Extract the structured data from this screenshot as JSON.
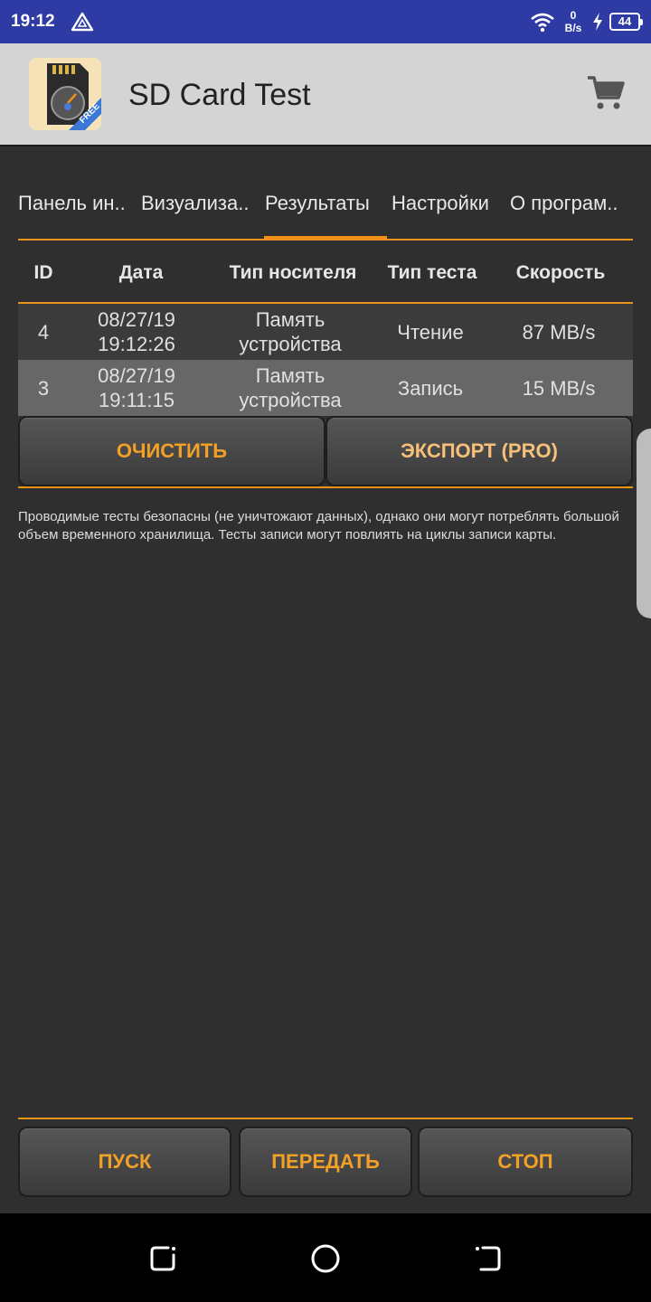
{
  "status_bar": {
    "time": "19:12",
    "net_speed_value": "0",
    "net_speed_unit": "B/s",
    "battery": "44"
  },
  "app_bar": {
    "title": "SD Card Test",
    "icon_badge": "FREE"
  },
  "tabs": [
    {
      "label": "Панель ин.."
    },
    {
      "label": "Визуализа.."
    },
    {
      "label": "Результаты",
      "selected": true
    },
    {
      "label": "Настройки"
    },
    {
      "label": "О програм.."
    }
  ],
  "table": {
    "headers": {
      "id": "ID",
      "date": "Дата",
      "media": "Тип носителя",
      "test_type": "Тип теста",
      "speed": "Скорость"
    },
    "rows": [
      {
        "id": "4",
        "date": "08/27/19",
        "time": "19:12:26",
        "media_l1": "Память",
        "media_l2": "устройства",
        "test_type": "Чтение",
        "speed": "87 MB/s"
      },
      {
        "id": "3",
        "date": "08/27/19",
        "time": "19:11:15",
        "media_l1": "Память",
        "media_l2": "устройства",
        "test_type": "Запись",
        "speed": "15 MB/s"
      }
    ]
  },
  "buttons": {
    "clear": "ОЧИСТИТЬ",
    "export": "ЭКСПОРТ (PRO)",
    "start": "ПУСК",
    "send": "ПЕРЕДАТЬ",
    "stop": "СТОП"
  },
  "notice": "Проводимые тесты безопасны (не уничтожают данных), однако они могут потреблять большой объем временного хранилища. Тесты записи могут повлиять на циклы записи карты.",
  "colors": {
    "status_bar": "#2f3ba4",
    "app_bar": "#d4d4d4",
    "background": "#2f2f2f",
    "accent": "#f0901a",
    "button_text": "#f2a126"
  },
  "icons": [
    "warning-triangle-icon",
    "wifi-icon",
    "charging-bolt-icon",
    "battery-icon",
    "shopping-cart-icon",
    "nav-recents-icon",
    "nav-home-icon",
    "nav-back-icon"
  ]
}
